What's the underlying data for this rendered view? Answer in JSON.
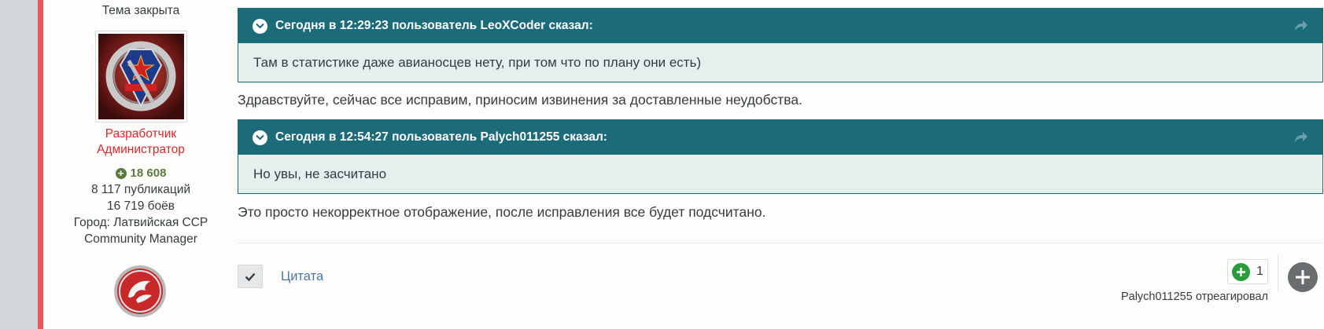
{
  "sidebar": {
    "topic_status": "Тема закрыта",
    "role_primary": "Разработчик",
    "role_secondary": "Администратор",
    "reputation": "18 608",
    "posts": "8 117 публикаций",
    "battles": "16 719 боёв",
    "city": "Город: Латвийская ССР",
    "title": "Community Manager"
  },
  "post": {
    "quotes": [
      {
        "header": "Сегодня в 12:29:23 пользователь LeoXCoder сказал:",
        "body": "Там в статистике даже авианосцев нету, при том что по плану они есть)"
      },
      {
        "header": "Сегодня в 12:54:27 пользователь Palych011255 сказал:",
        "body": "Но увы, не засчитано"
      }
    ],
    "replies": [
      "Здравствуйте, сейчас все исправим, приносим извинения за доставленные неудобства.",
      "Это просто некорректное отображение, после исправления все будет подсчитано."
    ]
  },
  "footer": {
    "quote_label": "Цитата",
    "reaction_count": "1",
    "reacted_by": "Palych011255 отреагировал"
  },
  "colors": {
    "accent_red": "#e8585a",
    "quote_header": "#1c6b7a",
    "quote_body": "#e5efee",
    "role_red": "#e0262a",
    "rep_green": "#5a7a3e",
    "link_blue": "#4a76a8",
    "reaction_green": "#2a9c3e"
  }
}
